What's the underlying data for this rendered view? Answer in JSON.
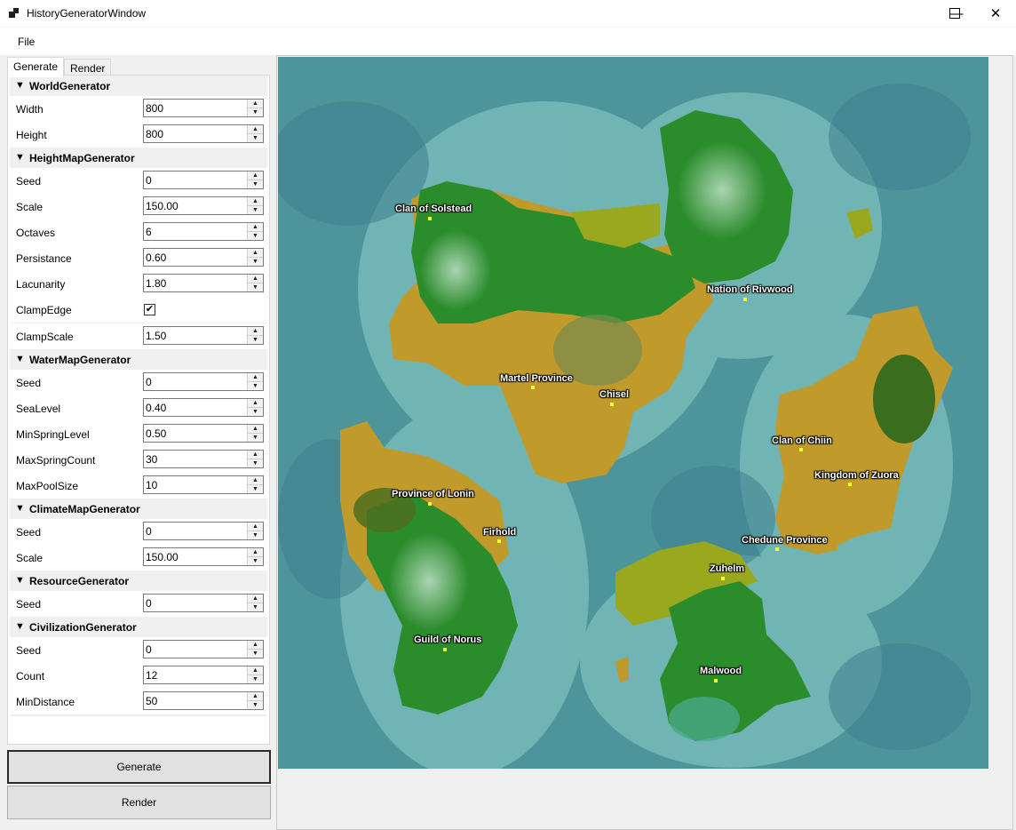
{
  "window": {
    "title": "HistoryGeneratorWindow",
    "minimize": "—",
    "maximize": "☐",
    "close": "✕"
  },
  "menu": {
    "file": "File"
  },
  "tabs": {
    "generate": "Generate",
    "render": "Render"
  },
  "groups": {
    "world": {
      "title": "WorldGenerator",
      "width_label": "Width",
      "width": "800",
      "height_label": "Height",
      "height": "800"
    },
    "heightmap": {
      "title": "HeightMapGenerator",
      "seed_label": "Seed",
      "seed": "0",
      "scale_label": "Scale",
      "scale": "150.00",
      "octaves_label": "Octaves",
      "octaves": "6",
      "persistance_label": "Persistance",
      "persistance": "0.60",
      "lacunarity_label": "Lacunarity",
      "lacunarity": "1.80",
      "clampedge_label": "ClampEdge",
      "clampedge": "✔",
      "clampscale_label": "ClampScale",
      "clampscale": "1.50"
    },
    "water": {
      "title": "WaterMapGenerator",
      "seed_label": "Seed",
      "seed": "0",
      "sealevel_label": "SeaLevel",
      "sealevel": "0.40",
      "minspring_label": "MinSpringLevel",
      "minspring": "0.50",
      "maxspring_label": "MaxSpringCount",
      "maxspring": "30",
      "maxpool_label": "MaxPoolSize",
      "maxpool": "10"
    },
    "climate": {
      "title": "ClimateMapGenerator",
      "seed_label": "Seed",
      "seed": "0",
      "scale_label": "Scale",
      "scale": "150.00"
    },
    "resource": {
      "title": "ResourceGenerator",
      "seed_label": "Seed",
      "seed": "0"
    },
    "civ": {
      "title": "CivilizationGenerator",
      "seed_label": "Seed",
      "seed": "0",
      "count_label": "Count",
      "count": "12",
      "mindist_label": "MinDistance",
      "mindist": "50"
    }
  },
  "buttons": {
    "generate": "Generate",
    "render": "Render"
  },
  "map_labels": {
    "solstead": "Clan of Solstead",
    "rivwood": "Nation of Rivwood",
    "martel": "Martel Province",
    "chisel": "Chisel",
    "chiin": "Clan of Chiin",
    "zuora": "Kingdom of Zuora",
    "lonin": "Province of Lonin",
    "firhold": "Firhold",
    "chedune": "Chedune Province",
    "zuhelm": "Zuhelm",
    "norus": "Guild of Norus",
    "malwood": "Malwood"
  },
  "colors": {
    "ocean": "#4a8f97",
    "shallow": "#7fc0bf",
    "forest": "#2f8f2f",
    "desert": "#c09a2a",
    "city_dot": "#ffff33"
  }
}
